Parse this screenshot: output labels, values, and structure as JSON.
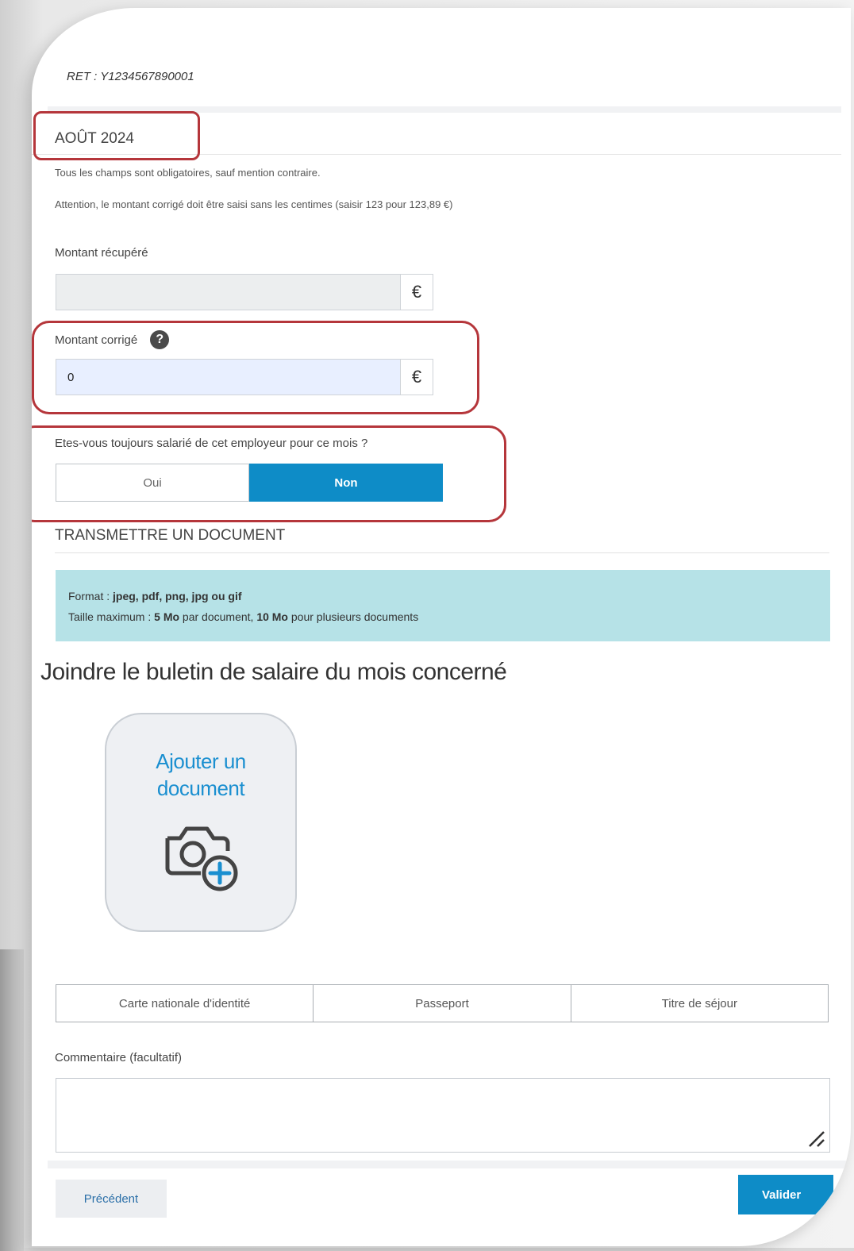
{
  "siret": "RET : Y1234567890001",
  "period": "AOÛT 2024",
  "info": {
    "line1": "Tous les champs sont obligatoires, sauf mention contraire.",
    "line2": "Attention, le montant corrigé doit être saisi sans les centimes (saisir 123 pour 123,89 €)"
  },
  "montant_recupere": {
    "label": "Montant récupéré",
    "value": "",
    "currency": "€"
  },
  "montant_corrige": {
    "label": "Montant corrigé",
    "value": "0",
    "currency": "€",
    "help_icon": "?"
  },
  "question": {
    "label": "Etes-vous toujours salarié de cet employeur pour ce mois ?",
    "options": [
      "Oui",
      "Non"
    ],
    "selected": "Non"
  },
  "transmit": {
    "title": "TRANSMETTRE UN DOCUMENT",
    "format_label": "Format : ",
    "format_value": "jpeg, pdf, png, jpg ou gif",
    "size_label": "Taille maximum : ",
    "size_value1": "5 Mo",
    "size_text1": " par document, ",
    "size_value2": "10 Mo",
    "size_text2": " pour plusieurs documents"
  },
  "join_label": "Joindre le buletin de salaire du mois concerné",
  "add_document": {
    "label_line1": "Ajouter un",
    "label_line2": "document",
    "icon": "camera-plus-icon"
  },
  "id_types": [
    "Carte nationale d'identité",
    "Passeport",
    "Titre de séjour"
  ],
  "comment": {
    "label": "Commentaire (facultatif)",
    "value": ""
  },
  "buttons": {
    "previous": "Précédent",
    "validate": "Valider"
  },
  "colors": {
    "accent": "#0e8cc7",
    "highlight_box": "#b5363b",
    "info_bg": "#b6e2e7",
    "link": "#1a8fd0"
  }
}
